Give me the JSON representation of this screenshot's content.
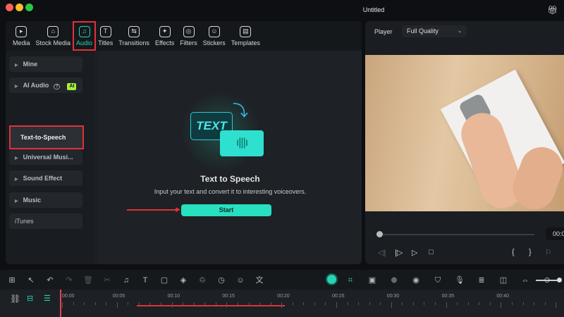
{
  "window": {
    "title": "Untitled"
  },
  "tabs": [
    {
      "label": "Media",
      "icon": "▸"
    },
    {
      "label": "Stock Media",
      "icon": "⌂"
    },
    {
      "label": "Audio",
      "icon": "♫"
    },
    {
      "label": "Titles",
      "icon": "T"
    },
    {
      "label": "Transitions",
      "icon": "⇆"
    },
    {
      "label": "Effects",
      "icon": "✦"
    },
    {
      "label": "Filters",
      "icon": "◎"
    },
    {
      "label": "Stickers",
      "icon": "☺"
    },
    {
      "label": "Templates",
      "icon": "▤"
    }
  ],
  "sidebar": {
    "mine": "Mine",
    "ai_audio": "AI Audio",
    "ai_badge": "AI",
    "help": "?",
    "tts": "Text-to-Speech",
    "universal": "Universal Musi...",
    "sound_effect": "Sound Effect",
    "music": "Music",
    "itunes": "iTunes"
  },
  "main": {
    "art_text": "TEXT",
    "heading": "Text to Speech",
    "description": "Input your text and convert it to interesting voiceovers.",
    "start": "Start"
  },
  "player": {
    "label": "Player",
    "quality": "Full Quality",
    "time": "00:0"
  },
  "timeline": {
    "ticks": [
      "00:00",
      "00:05",
      "00:10",
      "00:15",
      "00:20",
      "00:25",
      "00:30",
      "00:35",
      "00:40"
    ]
  },
  "colors": {
    "accent": "#27d3b3",
    "highlight": "#e0313a"
  }
}
